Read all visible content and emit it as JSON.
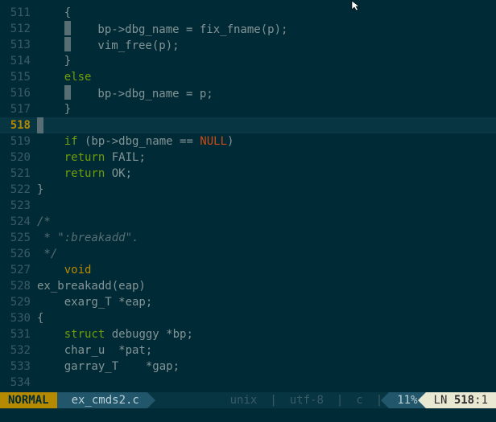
{
  "lines": [
    {
      "n": 511,
      "indent": "    ",
      "html": "{"
    },
    {
      "n": 512,
      "indent": "    ",
      "highlight_indent": true,
      "html": "    bp-&gt;dbg_name = fix_fname(p);"
    },
    {
      "n": 513,
      "indent": "    ",
      "highlight_indent": true,
      "html": "    vim_free(p);"
    },
    {
      "n": 514,
      "indent": "    ",
      "html": "}"
    },
    {
      "n": 515,
      "indent": "    ",
      "html": "<span class=\"kw\">else</span>"
    },
    {
      "n": 516,
      "indent": "    ",
      "highlight_indent": true,
      "html": "    bp-&gt;dbg_name = p;"
    },
    {
      "n": 517,
      "indent": "    ",
      "html": "}"
    },
    {
      "n": 518,
      "indent": "",
      "current": true,
      "html": ""
    },
    {
      "n": 519,
      "indent": "    ",
      "html": "<span class=\"kw\">if</span> (bp-&gt;dbg_name == <span class=\"const\">NULL</span>)"
    },
    {
      "n": 520,
      "indent": "    ",
      "html": "<span class=\"kw\">return</span> FAIL;"
    },
    {
      "n": 521,
      "indent": "    ",
      "html": "<span class=\"kw\">return</span> OK;"
    },
    {
      "n": 522,
      "indent": "",
      "html": "}"
    },
    {
      "n": 523,
      "indent": "",
      "html": ""
    },
    {
      "n": 524,
      "indent": "",
      "html": "<span class=\"cmnt\">/*</span>"
    },
    {
      "n": 525,
      "indent": "",
      "html": "<span class=\"cmnt\"> * \":breakadd\".</span>"
    },
    {
      "n": 526,
      "indent": "",
      "html": "<span class=\"cmnt\"> */</span>"
    },
    {
      "n": 527,
      "indent": "    ",
      "html": "<span class=\"type\">void</span>"
    },
    {
      "n": 528,
      "indent": "",
      "html": "ex_breakadd(eap)"
    },
    {
      "n": 529,
      "indent": "    ",
      "html": "exarg_T *eap;"
    },
    {
      "n": 530,
      "indent": "",
      "html": "{"
    },
    {
      "n": 531,
      "indent": "    ",
      "html": "<span class=\"kw\">struct</span> debuggy *bp;"
    },
    {
      "n": 532,
      "indent": "    ",
      "html": "char_u  *pat;"
    },
    {
      "n": 533,
      "indent": "    ",
      "html": "garray_T    *gap;"
    },
    {
      "n": 534,
      "indent": "",
      "html": ""
    }
  ],
  "status": {
    "mode": "NORMAL",
    "filename": "ex_cmds2.c",
    "fileformat": "unix",
    "encoding": "utf-8",
    "filetype": "c",
    "percent": "11%",
    "pos_label": "LN",
    "line": "518",
    "col": "1"
  }
}
